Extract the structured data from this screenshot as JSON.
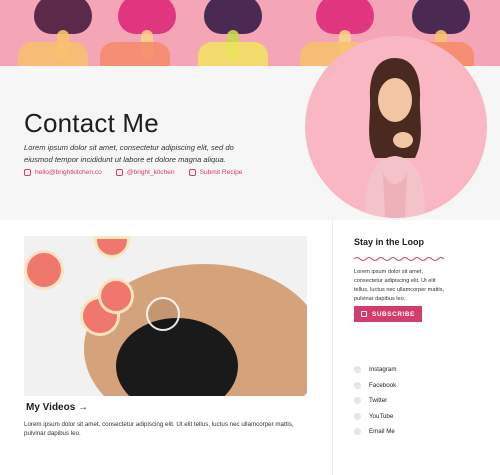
{
  "header": {
    "title": "Contact Me",
    "intro": "Lorem ipsum dolor sit amet, consectetur adipiscing elit, sed do eiusmod tempor incididunt ut labore et dolore magna aliqua.",
    "links": [
      {
        "label": "hello@brightkitchen.co",
        "icon": "send-icon"
      },
      {
        "label": "@bright_kitchen",
        "icon": "twitter-icon"
      },
      {
        "label": "Submit Recipe",
        "icon": "edit-icon"
      }
    ]
  },
  "main": {
    "videos_title": "My Videos →",
    "videos_text": "Lorem ipsum dolor sit amet, consectetur adipiscing elit. Ut elit tellus, luctus nec ullamcorper mattis, pulvinar dapibus leo."
  },
  "sidebar": {
    "title": "Stay in the Loop",
    "text": "Lorem ipsum dolor sit amet, consectetur adipiscing elit. Ut elit tellus, luctus nec ullamcorper mattis, pulvinar dapibus leo.",
    "subscribe_label": "SUBSCRIBE",
    "social": [
      {
        "label": "Instagram",
        "icon": "instagram-icon"
      },
      {
        "label": "Facebook",
        "icon": "facebook-icon"
      },
      {
        "label": "Twitter",
        "icon": "twitter-icon"
      },
      {
        "label": "YouTube",
        "icon": "youtube-icon"
      },
      {
        "label": "Email Me",
        "icon": "mail-icon"
      }
    ]
  },
  "colors": {
    "accent": "#d43c6a",
    "banner": "#f4a6b6",
    "profile_bg": "#f8b7c2"
  }
}
